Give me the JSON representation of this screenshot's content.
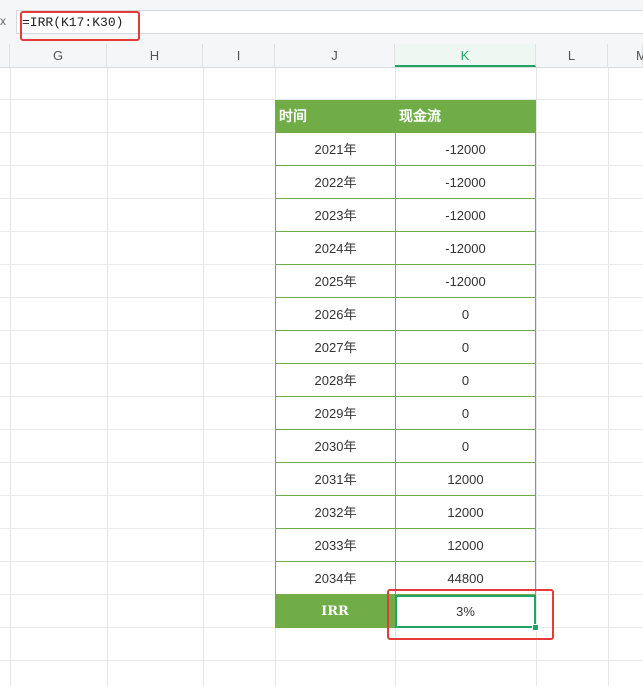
{
  "formula_bar": {
    "fx_label": "x",
    "formula": "=IRR(K17:K30)"
  },
  "columns": [
    "G",
    "H",
    "I",
    "J",
    "K",
    "L",
    "M"
  ],
  "table": {
    "header": {
      "time": "时间",
      "cashflow": "现金流"
    },
    "rows": [
      {
        "year": "2021年",
        "value": "-12000"
      },
      {
        "year": "2022年",
        "value": "-12000"
      },
      {
        "year": "2023年",
        "value": "-12000"
      },
      {
        "year": "2024年",
        "value": "-12000"
      },
      {
        "year": "2025年",
        "value": "-12000"
      },
      {
        "year": "2026年",
        "value": "0"
      },
      {
        "year": "2027年",
        "value": "0"
      },
      {
        "year": "2028年",
        "value": "0"
      },
      {
        "year": "2029年",
        "value": "0"
      },
      {
        "year": "2030年",
        "value": "0"
      },
      {
        "year": "2031年",
        "value": "12000"
      },
      {
        "year": "2032年",
        "value": "12000"
      },
      {
        "year": "2033年",
        "value": "12000"
      },
      {
        "year": "2034年",
        "value": "44800"
      }
    ],
    "irr": {
      "label": "IRR",
      "value": "3%"
    }
  },
  "colors": {
    "header_green": "#70ad47",
    "selection_green": "#21a366",
    "highlight_red": "#e43a3a"
  }
}
